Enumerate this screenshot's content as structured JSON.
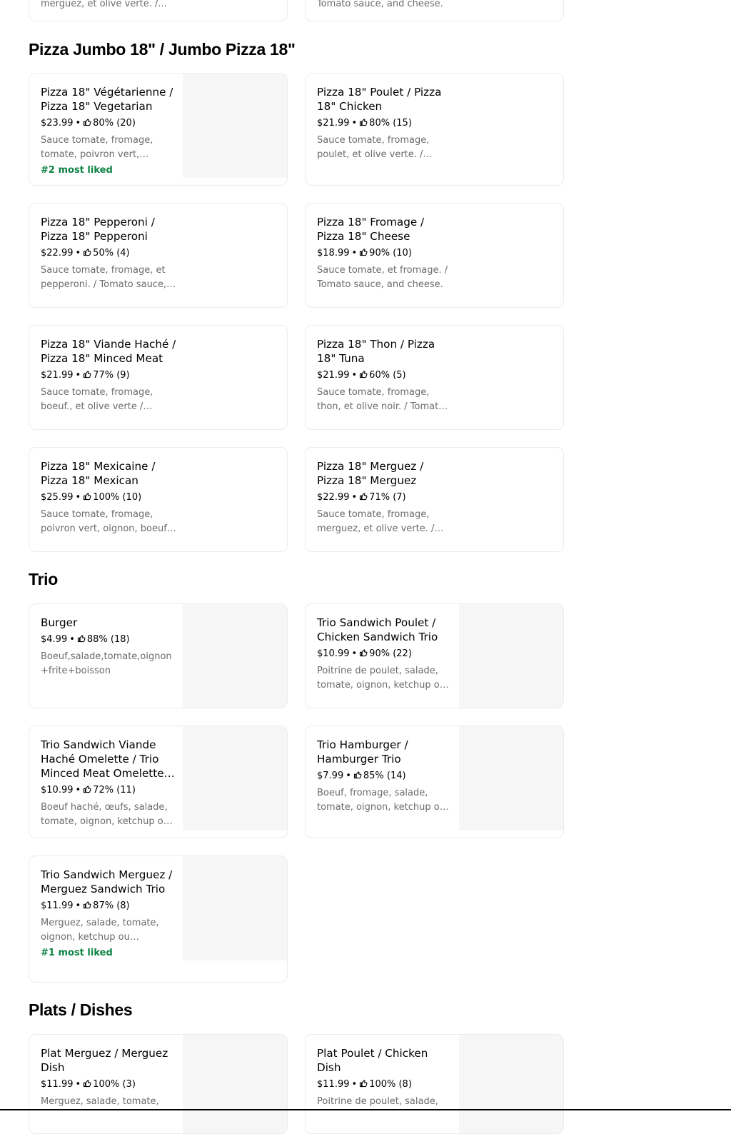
{
  "colors": {
    "badge": "#0e8345",
    "muted_text": "#6b6b6b",
    "image_placeholder": "#f6f6f6",
    "card_border": "#ececec"
  },
  "icons": {
    "rating": "thumbs-up-icon"
  },
  "top_partial": {
    "left_desc": "merguez, et olive verte. /...",
    "right_desc": "Tomato sauce, and cheese."
  },
  "sections": {
    "jumbo": {
      "title": "Pizza Jumbo 18\" / Jumbo Pizza 18\"",
      "items": [
        {
          "name": "Pizza 18\" Végétarienne / Pizza 18\" Vegetarian",
          "price": "$23.99",
          "rating": "80% (20)",
          "desc": "Sauce tomate, fromage, tomate, poivron vert, oignon, et olive verte.",
          "badge": "#2 most liked"
        },
        {
          "name": "Pizza 18\" Poulet / Pizza 18\" Chicken",
          "price": "$21.99",
          "rating": "80% (15)",
          "desc": "Sauce tomate, fromage, poulet, et olive verte. / Tomato sauce, cheese, chicken.",
          "badge": ""
        },
        {
          "name": "Pizza 18\" Pepperoni / Pizza 18\" Pepperoni",
          "price": "$22.99",
          "rating": "50% (4)",
          "desc": "Sauce tomate, fromage, et pepperoni. / Tomato sauce, cheese.",
          "badge": ""
        },
        {
          "name": "Pizza 18\" Fromage / Pizza 18\" Cheese",
          "price": "$18.99",
          "rating": "90% (10)",
          "desc": "Sauce tomate, et fromage. / Tomato sauce, and cheese.",
          "badge": ""
        },
        {
          "name": "Pizza 18\" Viande Haché / Pizza 18\" Minced Meat",
          "price": "$21.99",
          "rating": "77% (9)",
          "desc": "Sauce tomate, fromage, boeuf., et olive verte / Tomato sauce.",
          "badge": ""
        },
        {
          "name": "Pizza 18\" Thon / Pizza 18\" Tuna",
          "price": "$21.99",
          "rating": "60% (5)",
          "desc": "Sauce tomate, fromage, thon, et olive noir. / Tomato sauce.",
          "badge": ""
        },
        {
          "name": "Pizza 18\" Mexicaine / Pizza 18\" Mexican",
          "price": "$25.99",
          "rating": "100% (10)",
          "desc": "Sauce tomate, fromage, poivron vert, oignon, boeuf, piment.",
          "badge": ""
        },
        {
          "name": "Pizza 18\" Merguez  / Pizza 18\" Merguez",
          "price": "$22.99",
          "rating": "71% (7)",
          "desc": "Sauce tomate, fromage, merguez, et olive verte. / Tomato sauce.",
          "badge": ""
        }
      ]
    },
    "trio": {
      "title": "Trio",
      "items": [
        {
          "name": "Burger",
          "price": "$4.99",
          "rating": "88% (18)",
          "desc": "Boeuf,salade,tomate,oignon +frite+boisson",
          "badge": ""
        },
        {
          "name": "Trio Sandwich Poulet / Chicken Sandwich Trio",
          "price": "$10.99",
          "rating": "90% (22)",
          "desc": "Poitrine de poulet, salade, tomate, oignon, ketchup ou mayonnaise.",
          "badge": ""
        },
        {
          "name": "Trio Sandwich Viande Haché Omelette / Trio Minced Meat Omelette Sandwich",
          "price": "$10.99",
          "rating": "72% (11)",
          "desc": "Boeuf haché, œufs, salade, tomate, oignon, ketchup ou mayonnaise.",
          "badge": ""
        },
        {
          "name": "Trio Hamburger / Hamburger Trio",
          "price": "$7.99",
          "rating": "85% (14)",
          "desc": "Boeuf, fromage, salade, tomate, oignon, ketchup ou mayonnaise.",
          "badge": ""
        },
        {
          "name": "Trio Sandwich Merguez / Merguez Sandwich Trio",
          "price": "$11.99",
          "rating": "87% (8)",
          "desc": "Merguez, salade, tomate, oignon, ketchup ou mayonnaise.",
          "badge": "#1 most liked"
        }
      ]
    },
    "plats": {
      "title": "Plats / Dishes",
      "items": [
        {
          "name": "Plat Merguez / Merguez Dish",
          "price": "$11.99",
          "rating": "100% (3)",
          "desc": "Merguez, salade, tomate,",
          "badge": ""
        },
        {
          "name": "Plat Poulet / Chicken Dish",
          "price": "$11.99",
          "rating": "100% (8)",
          "desc": "Poitrine de poulet, salade,",
          "badge": ""
        }
      ]
    }
  }
}
